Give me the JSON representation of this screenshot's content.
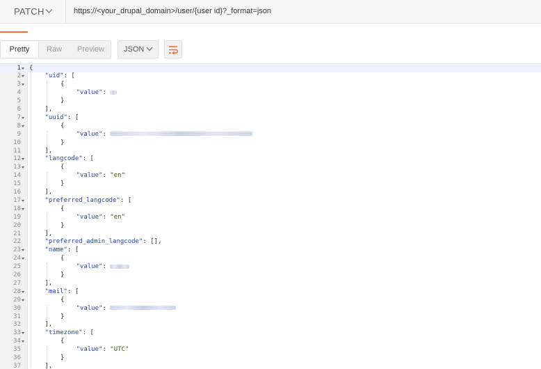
{
  "request": {
    "method": "PATCH",
    "url": "https://<your_drupal_domain>/user/{user id}?_format=json"
  },
  "response_toolbar": {
    "view_tabs": [
      "Pretty",
      "Raw",
      "Preview"
    ],
    "active_view": "Pretty",
    "format_label": "JSON"
  },
  "editor": {
    "active_line": 1,
    "lines": [
      {
        "n": "1",
        "fold": true,
        "indent": 0,
        "text": "{"
      },
      {
        "n": "2",
        "fold": true,
        "indent": 1,
        "key": "\"uid\"",
        "after": ": ["
      },
      {
        "n": "3",
        "fold": true,
        "indent": 2,
        "text": "{"
      },
      {
        "n": "4",
        "fold": false,
        "indent": 3,
        "key": "\"value\"",
        "after": ": ",
        "redacted": true
      },
      {
        "n": "5",
        "fold": false,
        "indent": 2,
        "text": "}"
      },
      {
        "n": "6",
        "fold": false,
        "indent": 1,
        "text": "],"
      },
      {
        "n": "7",
        "fold": true,
        "indent": 1,
        "key": "\"uuid\"",
        "after": ": ["
      },
      {
        "n": "8",
        "fold": true,
        "indent": 2,
        "text": "{"
      },
      {
        "n": "9",
        "fold": false,
        "indent": 3,
        "key": "\"value\"",
        "after": ": ",
        "redacted": true
      },
      {
        "n": "10",
        "fold": false,
        "indent": 2,
        "text": "}"
      },
      {
        "n": "11",
        "fold": false,
        "indent": 1,
        "text": "],"
      },
      {
        "n": "12",
        "fold": true,
        "indent": 1,
        "key": "\"langcode\"",
        "after": ": ["
      },
      {
        "n": "13",
        "fold": true,
        "indent": 2,
        "text": "{"
      },
      {
        "n": "14",
        "fold": false,
        "indent": 3,
        "key": "\"value\"",
        "after": ": ",
        "str": "\"en\""
      },
      {
        "n": "15",
        "fold": false,
        "indent": 2,
        "text": "}"
      },
      {
        "n": "16",
        "fold": false,
        "indent": 1,
        "text": "],"
      },
      {
        "n": "17",
        "fold": true,
        "indent": 1,
        "key": "\"preferred_langcode\"",
        "after": ": ["
      },
      {
        "n": "18",
        "fold": true,
        "indent": 2,
        "text": "{"
      },
      {
        "n": "19",
        "fold": false,
        "indent": 3,
        "key": "\"value\"",
        "after": ": ",
        "str": "\"en\""
      },
      {
        "n": "20",
        "fold": false,
        "indent": 2,
        "text": "}"
      },
      {
        "n": "21",
        "fold": false,
        "indent": 1,
        "text": "],"
      },
      {
        "n": "22",
        "fold": false,
        "indent": 1,
        "key": "\"preferred_admin_langcode\"",
        "after": ": [],"
      },
      {
        "n": "23",
        "fold": true,
        "indent": 1,
        "key": "\"name\"",
        "after": ": ["
      },
      {
        "n": "24",
        "fold": true,
        "indent": 2,
        "text": "{"
      },
      {
        "n": "25",
        "fold": false,
        "indent": 3,
        "key": "\"value\"",
        "after": ": ",
        "redacted": true
      },
      {
        "n": "26",
        "fold": false,
        "indent": 2,
        "text": "}"
      },
      {
        "n": "27",
        "fold": false,
        "indent": 1,
        "text": "],"
      },
      {
        "n": "28",
        "fold": true,
        "indent": 1,
        "key": "\"mail\"",
        "after": ": ["
      },
      {
        "n": "29",
        "fold": true,
        "indent": 2,
        "text": "{"
      },
      {
        "n": "30",
        "fold": false,
        "indent": 3,
        "key": "\"value\"",
        "after": ": ",
        "redacted": true
      },
      {
        "n": "31",
        "fold": false,
        "indent": 2,
        "text": "}"
      },
      {
        "n": "32",
        "fold": false,
        "indent": 1,
        "text": "],"
      },
      {
        "n": "33",
        "fold": true,
        "indent": 1,
        "key": "\"timezone\"",
        "after": ": ["
      },
      {
        "n": "34",
        "fold": true,
        "indent": 2,
        "text": "{"
      },
      {
        "n": "35",
        "fold": false,
        "indent": 3,
        "key": "\"value\"",
        "after": ": ",
        "str": "\"UTC\""
      },
      {
        "n": "36",
        "fold": false,
        "indent": 2,
        "text": "}"
      },
      {
        "n": "37",
        "fold": false,
        "indent": 1,
        "text": "],"
      }
    ]
  }
}
